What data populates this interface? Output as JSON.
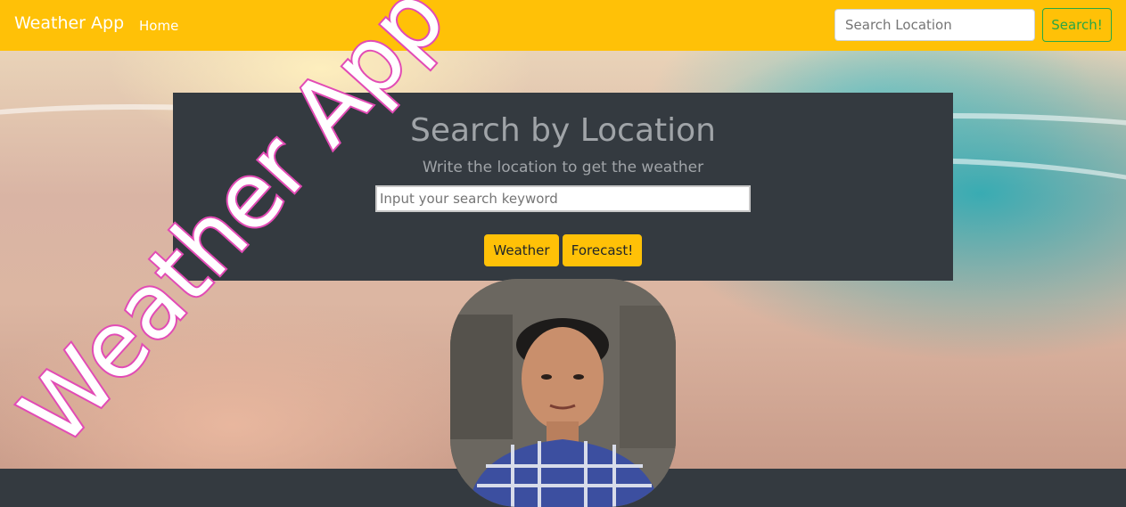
{
  "navbar": {
    "brand": "Weather App",
    "home": "Home",
    "search_placeholder": "Search Location",
    "search_button": "Search!"
  },
  "panel": {
    "title": "Search by Location",
    "subtitle": "Write the location to get the weather",
    "keyword_placeholder": "Input your search keyword",
    "weather_button": "Weather",
    "forecast_button": "Forecast!"
  },
  "overlay": {
    "watermark": "Weather App"
  },
  "colors": {
    "navbar": "#ffc107",
    "panel": "#343a40",
    "search_button": "#28a745",
    "watermark_stroke": "#e24bb5"
  }
}
